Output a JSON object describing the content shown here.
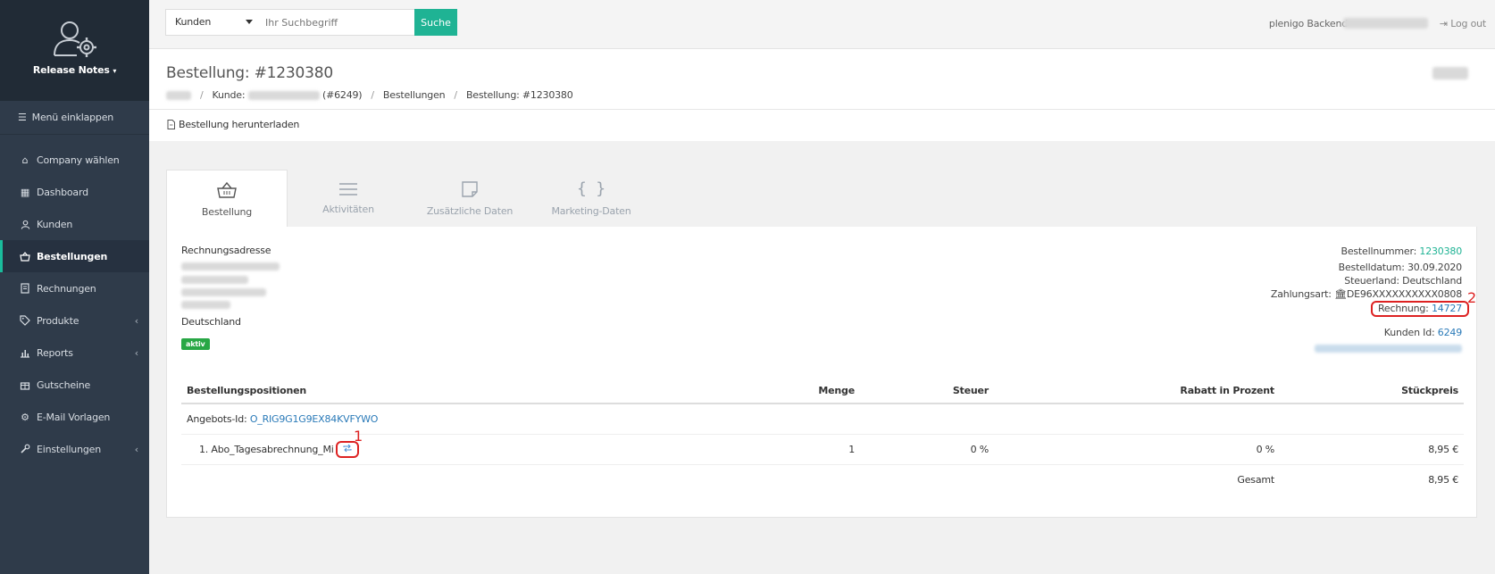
{
  "sidebar": {
    "brand_label": "Release Notes",
    "collapse_label": "Menü einklappen",
    "items": [
      {
        "label": "Company wählen",
        "icon": "home-icon"
      },
      {
        "label": "Dashboard",
        "icon": "grid-icon"
      },
      {
        "label": "Kunden",
        "icon": "user-icon"
      },
      {
        "label": "Bestellungen",
        "icon": "basket-icon",
        "active": true
      },
      {
        "label": "Rechnungen",
        "icon": "document-icon"
      },
      {
        "label": "Produkte",
        "icon": "tag-icon"
      },
      {
        "label": "Reports",
        "icon": "chart-icon"
      },
      {
        "label": "Gutscheine",
        "icon": "gift-icon"
      },
      {
        "label": "E-Mail Vorlagen",
        "icon": "gears-icon"
      },
      {
        "label": "Einstellungen",
        "icon": "wrench-icon"
      }
    ]
  },
  "topbar": {
    "search_scope": "Kunden",
    "search_placeholder": "Ihr Suchbegriff",
    "search_button": "Suche",
    "backend_label": "plenigo Backend",
    "logout_label": "Log out"
  },
  "header": {
    "title": "Bestellung: #1230380",
    "breadcrumb": {
      "customer_prefix": "Kunde:",
      "customer_id": "(#6249)",
      "orders": "Bestellungen",
      "current": "Bestellung: #1230380"
    },
    "download_label": "Bestellung herunterladen"
  },
  "tabs": [
    {
      "label": "Bestellung",
      "icon": "basket-icon",
      "active": true
    },
    {
      "label": "Aktivitäten",
      "icon": "lines-icon"
    },
    {
      "label": "Zusätzliche Daten",
      "icon": "note-icon"
    },
    {
      "label": "Marketing-Daten",
      "icon": "braces-icon"
    }
  ],
  "address": {
    "title": "Rechnungsadresse",
    "country": "Deutschland",
    "status_badge": "aktiv"
  },
  "meta": {
    "order_number_label": "Bestellnummer:",
    "order_number": "1230380",
    "order_date": "Bestelldatum: 30.09.2020",
    "tax_country": "Steuerland: Deutschland",
    "payment_label": "Zahlungsart:",
    "payment_value": "DE96XXXXXXXXXX0808",
    "invoice_label": "Rechnung:",
    "invoice_number": "14727",
    "customer_id_label": "Kunden Id:",
    "customer_id": "6249"
  },
  "markers": {
    "one": "1",
    "two": "2"
  },
  "positions": {
    "headers": [
      "Bestellungspositionen",
      "Menge",
      "Steuer",
      "Rabatt in Prozent",
      "Stückpreis"
    ],
    "offer_label": "Angebots-Id:",
    "offer_id": "O_RIG9G1G9EX84KVFYWO",
    "item_name": "1. Abo_Tagesabrechnung_Mi",
    "item_qty": "1",
    "item_tax": "0 %",
    "item_discount": "0 %",
    "item_price": "8,95 €",
    "total_label": "Gesamt",
    "total_value": "8,95 €"
  }
}
